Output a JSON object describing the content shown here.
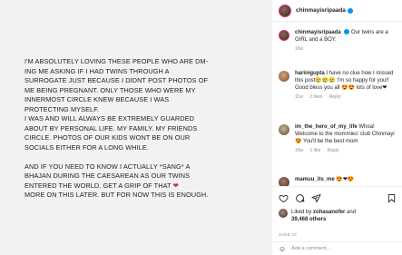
{
  "post": {
    "lines": [
      "I'M ABSOLUTELY LOVING THESE PEOPLE WHO ARE DM-",
      "ING ME ASKING IF I HAD TWINS THROUGH A",
      "SURROGATE JUST BECAUSE I DIDNT POST PHOTOS OF",
      "ME BEING PREGNANT. ONLY THOSE WHO WERE MY",
      "INNERMOST CIRCLE KNEW BECAUSE I WAS",
      "PROTECTING MYSELF.",
      "I WAS AND WILL ALWAYS BE EXTREMELY GUARDED",
      "ABOUT BY PERSONAL LIFE. MY FAMILY. MY FRIENDS",
      "CIRCLE. PHOTOS OF OUR KIDS WONT BE ON OUR",
      "SOCIALS EITHER FOR A LONG WHILE."
    ],
    "lines2": [
      "AND IF YOU NEED TO KNOW I ACTUALLY *SANG* A",
      "BHAJAN DURING THE CAESAREAN AS OUR TWINS",
      "ENTERED THE WORLD. GET A GRIP OF THAT",
      "MORE ON THIS LATER. BUT FOR NOW THIS IS ENOUGH."
    ],
    "heart": "❤"
  },
  "header": {
    "username": "chinmayisripaada"
  },
  "caption": {
    "username": "chinmayisripaada",
    "text": "Our twins are a GIRL and a BOY.",
    "time": "16w"
  },
  "comments": [
    {
      "username": "harinigupta",
      "text": "I have no clue how I missed this post😢😢😢 I'm so happy for you!! Good bless you all 😍😍 lots of love❤",
      "time": "11w",
      "likes": "2 likes",
      "reply": "Reply"
    },
    {
      "username": "im_the_hero_of_my_life",
      "text": "Whoa! Welcome to the mommies' club Chinmayi 😍 You'll be the best mom",
      "time": "15w",
      "likes": "1 like",
      "reply": "Reply"
    },
    {
      "username": "mamuu_its_me",
      "text": "😍❤😍"
    }
  ],
  "actions": {
    "liked_by_prefix": "Liked by",
    "liked_by_user": "zohasanofer",
    "and": "and",
    "likes_count": "39,468 others",
    "date": "JUNE 22",
    "add_comment_placeholder": "Add a comment..."
  },
  "icons": {
    "heart": "heart-icon",
    "comment": "comment-icon",
    "share": "share-icon",
    "save": "bookmark-icon",
    "emoji": "emoji-icon"
  },
  "colors": {
    "verified": "#0095f6",
    "heart": "#e0262f",
    "muted": "#8e8e8e"
  }
}
